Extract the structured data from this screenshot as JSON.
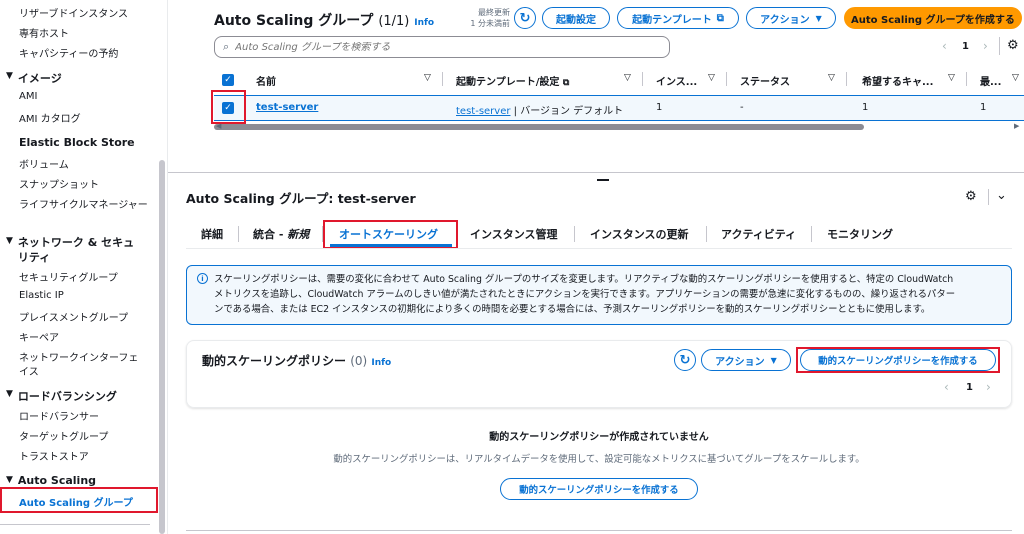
{
  "sidebar": {
    "items_top": [
      "リザーブドインスタンス",
      "専有ホスト",
      "キャパシティーの予約"
    ],
    "image_section": "イメージ",
    "image_items": [
      "AMI",
      "AMI カタログ"
    ],
    "ebs_section": "Elastic Block Store",
    "ebs_items": [
      "ボリューム",
      "スナップショット",
      "ライフサイクルマネージャー"
    ],
    "net_section_1": "ネットワーク & セキュ",
    "net_section_2": "リティ",
    "net_items": [
      "セキュリティグループ",
      "Elastic IP",
      "プレイスメントグループ",
      "キーペア",
      "ネットワークインターフェ",
      "イス"
    ],
    "lb_section": "ロードバランシング",
    "lb_items": [
      "ロードバランサー",
      "ターゲットグループ",
      "トラストストア"
    ],
    "as_section": "Auto Scaling",
    "as_items": [
      "Auto Scaling グループ"
    ]
  },
  "header": {
    "title": "Auto Scaling グループ",
    "count": "(1/1)",
    "info": "Info",
    "last_updated_label": "最終更新",
    "last_updated_value": "1 分未満前",
    "launch_config": "起動設定",
    "launch_template": "起動テンプレート",
    "actions": "アクション",
    "create": "Auto Scaling グループを作成する",
    "search_placeholder": "Auto Scaling グループを検索する",
    "page": "1"
  },
  "table": {
    "columns": [
      "名前",
      "起動テンプレート/設定",
      "インス...",
      "ステータス",
      "希望するキャ...",
      "最..."
    ],
    "row": {
      "name": "test-server",
      "template_link": "test-server",
      "template_rest": " | バージョン デフォルト",
      "instances": "1",
      "status": "-",
      "desired": "1",
      "min": "1"
    }
  },
  "detail": {
    "title": "Auto Scaling グループ: test-server",
    "tabs": [
      "詳細",
      "統合 - ",
      "新規",
      "オートスケーリング",
      "インスタンス管理",
      "インスタンスの更新",
      "アクティビティ",
      "モニタリング"
    ],
    "info_lines": [
      "スケーリングポリシーは、需要の変化に合わせて Auto Scaling グループのサイズを変更します。リアクティブな動的スケーリングポリシーを使用すると、特定の CloudWatch",
      "メトリクスを追跡し、CloudWatch アラームのしきい値が満たされたときにアクションを実行できます。アプリケーションの需要が急速に変化するものの、繰り返されるパター",
      "ンである場合、または EC2 インスタンスの初期化により多くの時間を必要とする場合には、予測スケーリングポリシーを動的スケーリングポリシーとともに使用します。"
    ],
    "policy_title": "動的スケーリングポリシー",
    "policy_count": "(0)",
    "policy_info": "Info",
    "policy_actions": "アクション",
    "policy_create": "動的スケーリングポリシーを作成する",
    "policy_page": "1",
    "empty_title": "動的スケーリングポリシーが作成されていません",
    "empty_desc": "動的スケーリングポリシーは、リアルタイムデータを使用して、設定可能なメトリクスに基づいてグループをスケールします。",
    "empty_button": "動的スケーリングポリシーを作成する"
  }
}
